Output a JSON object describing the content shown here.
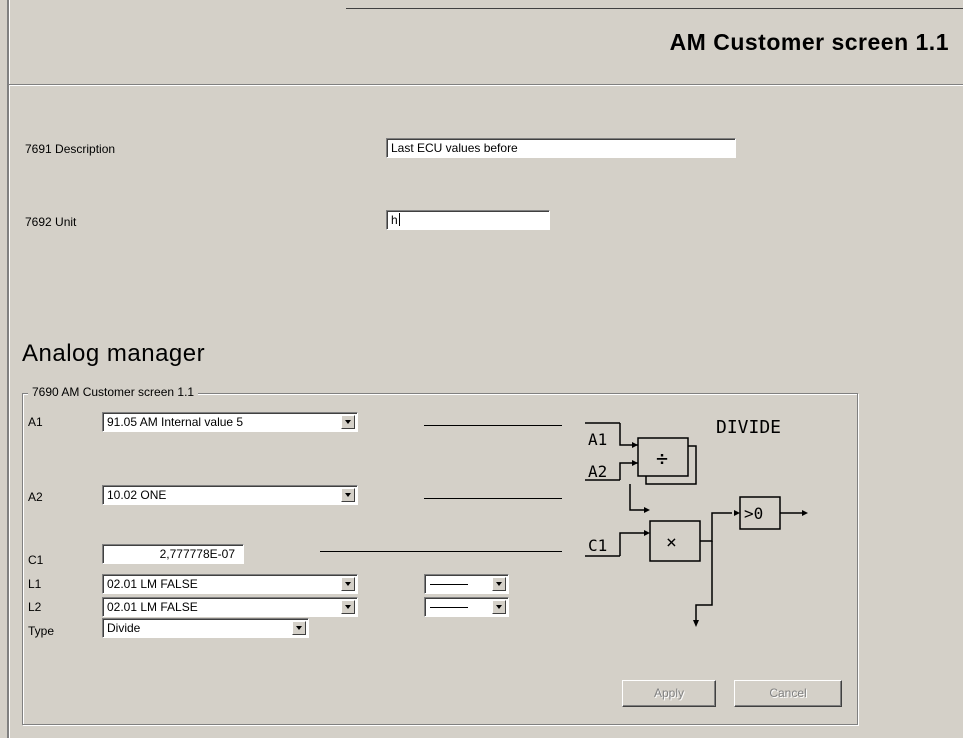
{
  "window": {
    "title": "AM Customer screen 1.1"
  },
  "fields": {
    "description": {
      "label": "7691 Description",
      "value": "Last ECU values before"
    },
    "unit": {
      "label": "7692 Unit",
      "value": "h"
    }
  },
  "analog_manager": {
    "title": "Analog manager",
    "group_label": "7690 AM Customer screen 1.1",
    "rows": {
      "a1": {
        "label": "A1",
        "value": "91.05 AM Internal value 5"
      },
      "a2": {
        "label": "A2",
        "value": "10.02 ONE"
      },
      "c1": {
        "label": "C1",
        "value": "2,777778E-07"
      },
      "l1": {
        "label": "L1",
        "value": "02.01 LM FALSE"
      },
      "l2": {
        "label": "L2",
        "value": "02.01 LM FALSE"
      },
      "type": {
        "label": "Type",
        "value": "Divide"
      }
    },
    "diagram": {
      "title": "DIVIDE",
      "input_a1": "A1",
      "input_a2": "A2",
      "input_c1": "C1",
      "divide_symbol": "÷",
      "multiply_symbol": "×",
      "output_symbol": ">0"
    },
    "buttons": {
      "apply": "Apply",
      "cancel": "Cancel"
    }
  }
}
